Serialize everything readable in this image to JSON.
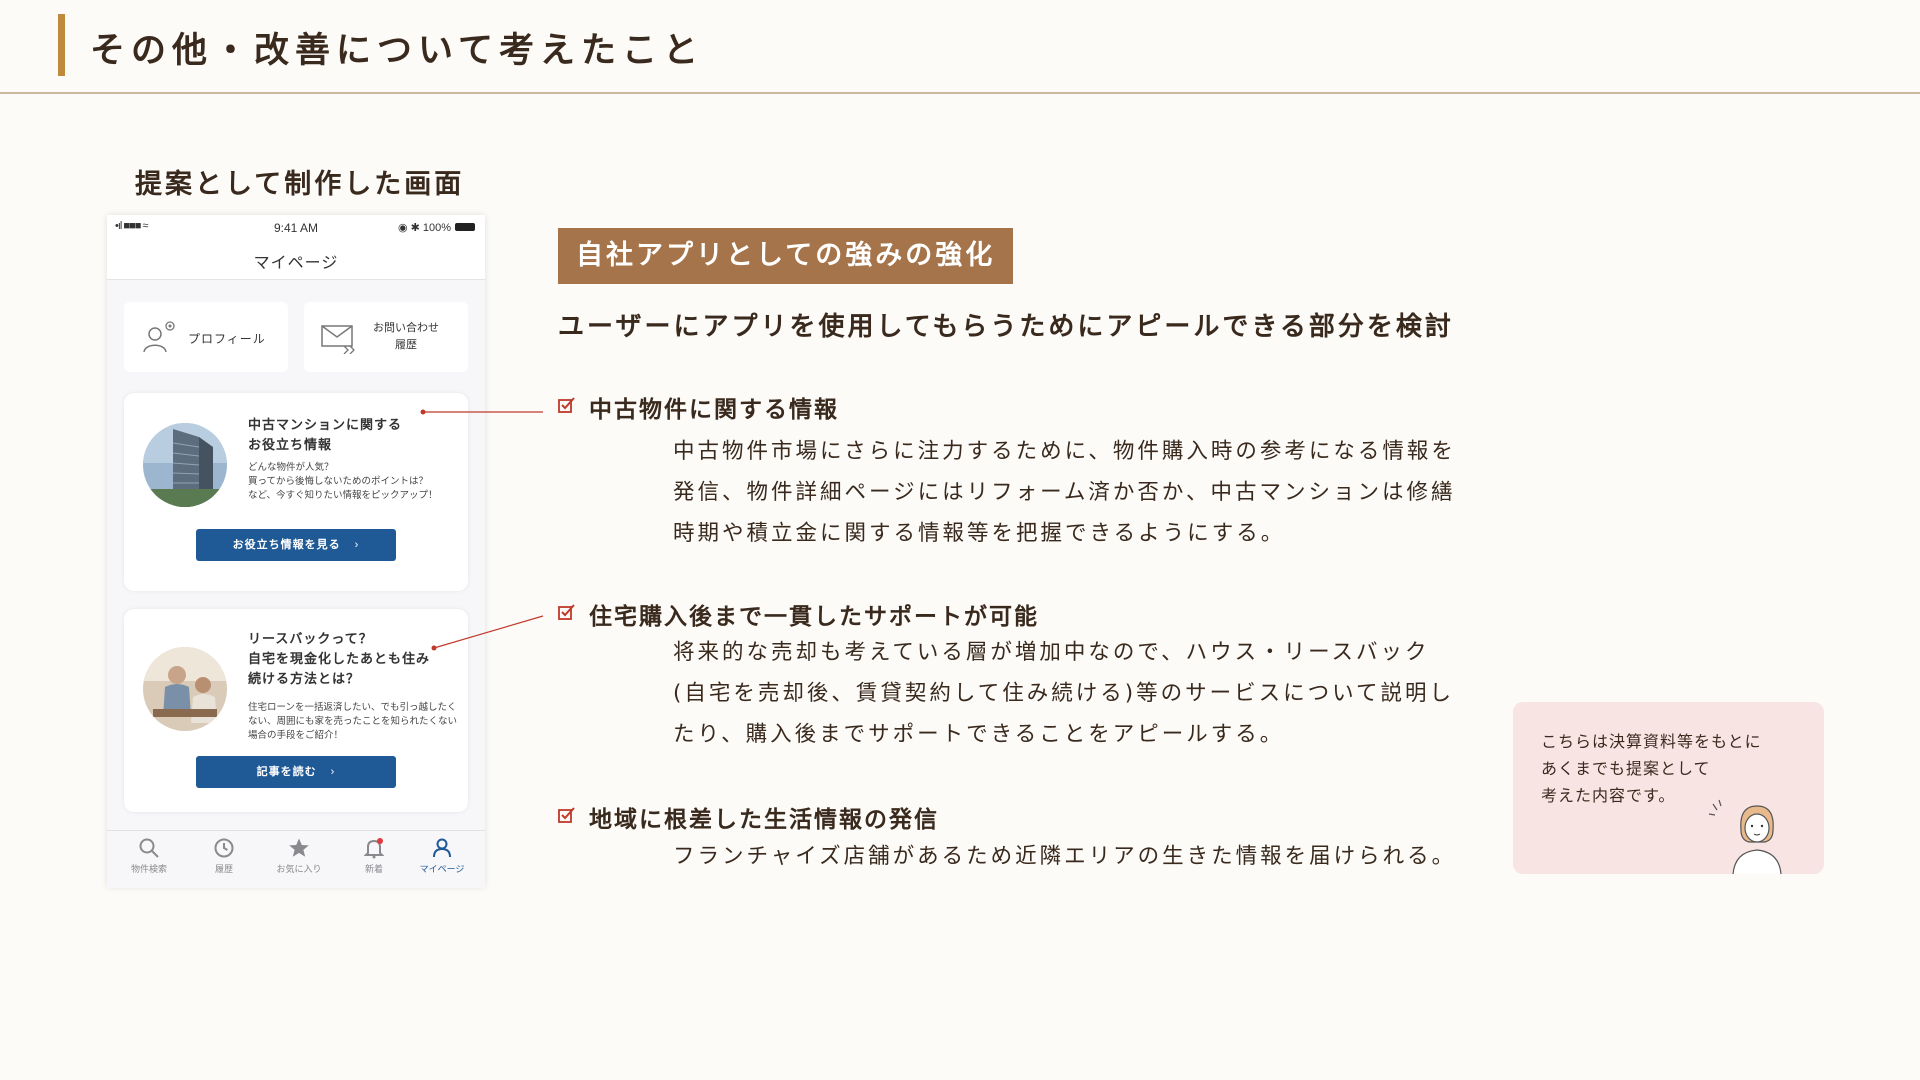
{
  "page": {
    "title": "その他・改善について考えたこと",
    "proposal_label": "提案として制作した画面"
  },
  "phone": {
    "status_bar": {
      "signal_text": "•ıl ■■■ ≈",
      "time": "9:41 AM",
      "battery_text": "◉ ✱ 100%"
    },
    "nav_title": "マイページ",
    "tiles": {
      "profile_label": "プロフィール",
      "inquiry_label": "お問い合わせ\n履歴"
    },
    "cards": [
      {
        "title": "中古マンションに関する\nお役立ち情報",
        "description": "どんな物件が人気？\n買ってから後悔しないためのポイントは？\nなど、今すぐ知りたい情報をピックアップ！",
        "button_label": "お役立ち情報を見る",
        "image": "building-photo"
      },
      {
        "title": "リースバックって？\n自宅を現金化したあとも住み\n続ける方法とは？",
        "description": "住宅ローンを一括返済したい、でも引っ越したくない、周囲にも家を売ったことを知られたくない場合の手段をご紹介！",
        "button_label": "記事を読む",
        "image": "couple-photo"
      }
    ],
    "tab_bar": [
      {
        "label": "物件検索",
        "icon": "search-icon"
      },
      {
        "label": "履歴",
        "icon": "clock-icon"
      },
      {
        "label": "お気に入り",
        "icon": "star-icon"
      },
      {
        "label": "新着",
        "icon": "bell-icon"
      },
      {
        "label": "マイページ",
        "icon": "user-icon",
        "active": true
      }
    ]
  },
  "section": {
    "badge": "自社アプリとしての強みの強化",
    "subtitle": "ユーザーにアプリを使用してもらうためにアピールできる部分を検討"
  },
  "points": [
    {
      "heading": "中古物件に関する情報",
      "body": "中古物件市場にさらに注力するために、物件購入時の参考になる情報を\n発信、物件詳細ページにはリフォーム済か否か、中古マンションは修繕\n時期や積立金に関する情報等を把握できるようにする。"
    },
    {
      "heading": "住宅購入後まで一貫したサポートが可能",
      "body": "将来的な売却も考えている層が増加中なので、ハウス・リースバック\n(自宅を売却後、賃貸契約して住み続ける)等のサービスについて説明し\nたり、購入後までサポートできることをアピールする。"
    },
    {
      "heading": "地域に根差した生活情報の発信",
      "body": "フランチャイズ店舗があるため近隣エリアの生きた情報を届けられる。"
    }
  ],
  "note": {
    "text": "こちらは決算資料等をもとに\nあくまでも提案として\n考えた内容です。"
  },
  "colors": {
    "accent_bar": "#c08a3e",
    "badge": "#a5744a",
    "button_blue": "#1f5a96",
    "note_bg": "#f9e4e4",
    "check_red": "#c0392b"
  }
}
